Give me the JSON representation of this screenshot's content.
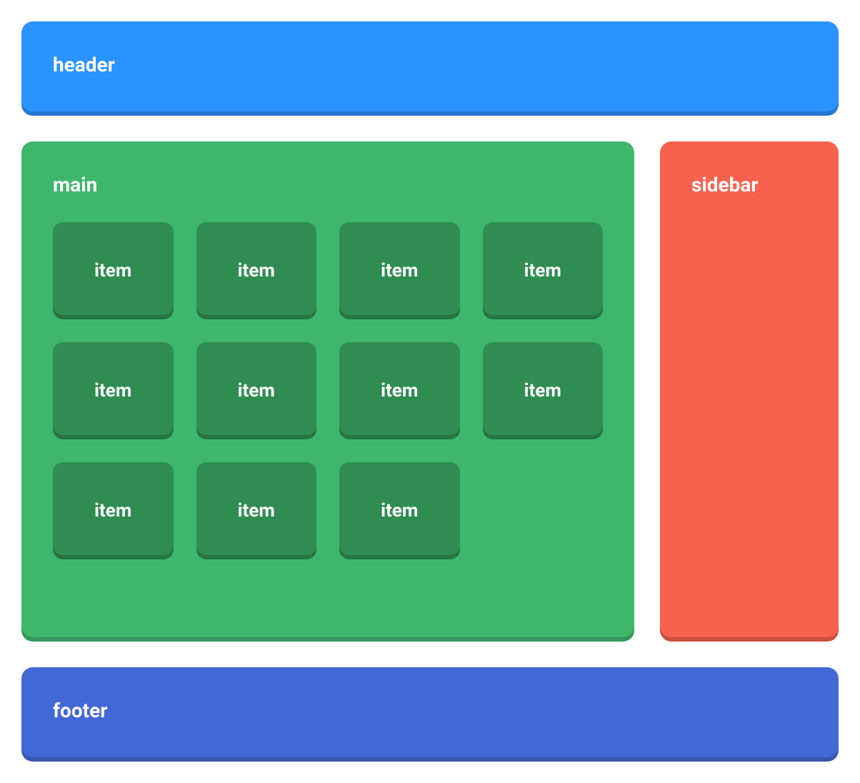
{
  "header": {
    "label": "header"
  },
  "main": {
    "label": "main",
    "items": [
      {
        "label": "item"
      },
      {
        "label": "item"
      },
      {
        "label": "item"
      },
      {
        "label": "item"
      },
      {
        "label": "item"
      },
      {
        "label": "item"
      },
      {
        "label": "item"
      },
      {
        "label": "item"
      },
      {
        "label": "item"
      },
      {
        "label": "item"
      },
      {
        "label": "item"
      }
    ]
  },
  "sidebar": {
    "label": "sidebar"
  },
  "footer": {
    "label": "footer"
  },
  "colors": {
    "header": "#2b93ff",
    "main": "#3eb76c",
    "item": "#2f8d52",
    "sidebar": "#f8614e",
    "footer": "#4268d6"
  }
}
